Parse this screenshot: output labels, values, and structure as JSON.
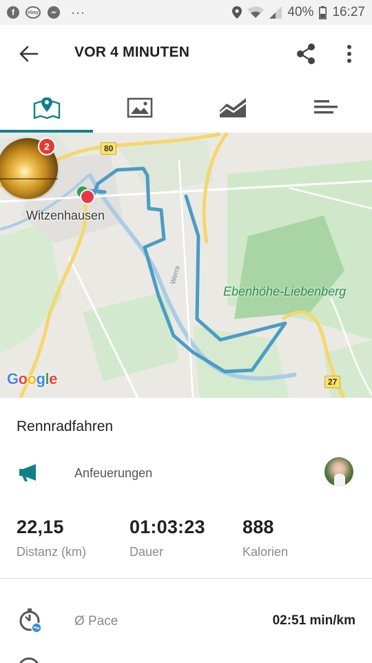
{
  "status_bar": {
    "battery": "40%",
    "time": "16:27",
    "ebay_label": "ebay",
    "icons": [
      "facebook-icon",
      "ebay-icon",
      "messenger-icon",
      "more-dots-icon",
      "location-icon",
      "wifi-icon",
      "signal-icon",
      "battery-icon"
    ]
  },
  "app_bar": {
    "title": "VOR 4 MINUTEN",
    "icons": [
      "back-arrow-icon",
      "share-icon",
      "more-vert-icon"
    ]
  },
  "tabs": [
    {
      "icon": "map-pin-icon",
      "active": true
    },
    {
      "icon": "image-icon",
      "active": false
    },
    {
      "icon": "chart-icon",
      "active": false
    },
    {
      "icon": "list-bars-icon",
      "active": false
    }
  ],
  "accent_color": "#11808a",
  "map": {
    "labels": {
      "town": "Witzenhausen",
      "area": "Ebenhöhe-Liebenberg",
      "river": "Werra"
    },
    "road_badges": [
      "80",
      "27"
    ],
    "provider": "Google",
    "notification_count": "2",
    "route_color": "#4a9cc4"
  },
  "activity": {
    "type": "Rennradfahren",
    "cheers_label": "Anfeuerungen",
    "stats": [
      {
        "value": "22,15",
        "label": "Distanz (km)"
      },
      {
        "value": "01:03:23",
        "label": "Dauer"
      },
      {
        "value": "888",
        "label": "Kalorien"
      }
    ],
    "pace": {
      "label": "Ø Pace",
      "value": "02:51 min/km"
    }
  }
}
